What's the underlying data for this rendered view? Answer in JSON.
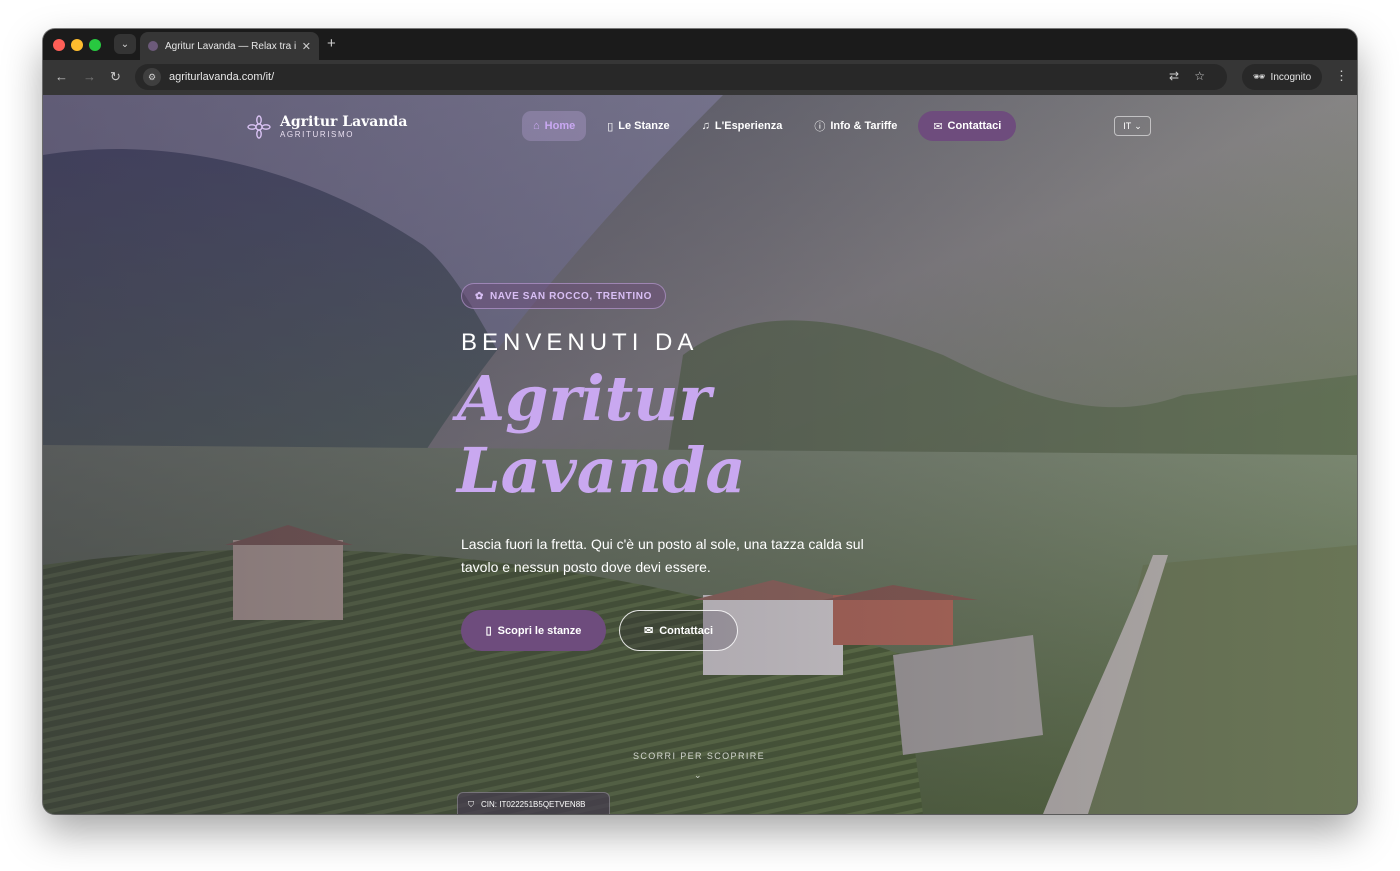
{
  "browser": {
    "tab_title": "Agritur Lavanda — Relax tra i",
    "url": "agriturlavanda.com/it/",
    "incognito_label": "Incognito"
  },
  "site": {
    "logo_name": "Agritur Lavanda",
    "logo_sub": "AGRITURISMO",
    "nav": [
      {
        "label": "Home",
        "icon": "home-icon"
      },
      {
        "label": "Le Stanze",
        "icon": "door-icon"
      },
      {
        "label": "L'Esperienza",
        "icon": "bell-icon"
      },
      {
        "label": "Info & Tariffe",
        "icon": "info-icon"
      },
      {
        "label": "Contattaci",
        "icon": "mail-icon"
      }
    ],
    "lang": "IT"
  },
  "hero": {
    "location": "NAVE SAN ROCCO, TRENTINO",
    "welcome": "BENVENUTI DA",
    "title_line1": "Agritur",
    "title_line2": "Lavanda",
    "tagline": "Lascia fuori la fretta. Qui c'è un posto al sole, una tazza calda sul tavolo e nessun posto dove devi essere.",
    "primary_cta": "Scopri le stanze",
    "secondary_cta": "Contattaci",
    "scroll_hint": "SCORRI PER SCOPRIRE",
    "cin": "CIN: IT022251B5QETVEN8B"
  },
  "colors": {
    "accent": "#6e4c7d",
    "title": "#c9a8f0"
  }
}
